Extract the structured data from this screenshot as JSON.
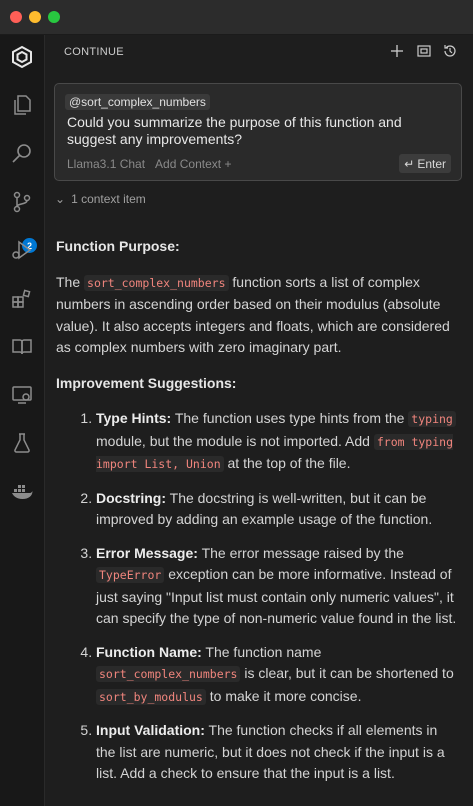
{
  "panel": {
    "title": "CONTINUE"
  },
  "activity": {
    "source_control_badge": "2"
  },
  "input": {
    "mention": "@sort_complex_numbers",
    "question": "Could you summarize the purpose of this function and suggest any improvements?",
    "model": "Llama3.1 Chat",
    "add_context": "Add Context",
    "add_context_plus": "+",
    "enter_label": "Enter"
  },
  "context": {
    "label": "1 context item"
  },
  "response": {
    "purpose_heading": "Function Purpose:",
    "purpose": {
      "t1": "The ",
      "c1": "sort_complex_numbers",
      "t2": " function sorts a list of complex numbers in ascending order based on their modulus (absolute value). It also accepts integers and floats, which are considered as complex numbers with zero imaginary part."
    },
    "improvements_heading": "Improvement Suggestions:",
    "items": [
      {
        "title": "Type Hints:",
        "t1": " The function uses type hints from the ",
        "c1": "typing",
        "t2": " module, but the module is not imported. Add ",
        "c2": "from typing import List, Union",
        "t3": " at the top of the file."
      },
      {
        "title": "Docstring:",
        "t1": " The docstring is well-written, but it can be improved by adding an example usage of the function."
      },
      {
        "title": "Error Message:",
        "t1": " The error message raised by the ",
        "c1": "TypeError",
        "t2": " exception can be more informative. Instead of just saying \"Input list must contain only numeric values\", it can specify the type of non-numeric value found in the list."
      },
      {
        "title": "Function Name:",
        "t1": " The function name ",
        "c1": "sort_complex_numbers",
        "t2": " is clear, but it can be shortened to ",
        "c2": "sort_by_modulus",
        "t3": " to make it more concise."
      },
      {
        "title": "Input Validation:",
        "t1": " The function checks if all elements in the list are numeric, but it does not check if the input is a list. Add a check to ensure that the input is a list."
      }
    ]
  },
  "colors": {
    "code_text": "#f0857d",
    "badge": "#0078d4",
    "background": "#1e1e1e"
  }
}
